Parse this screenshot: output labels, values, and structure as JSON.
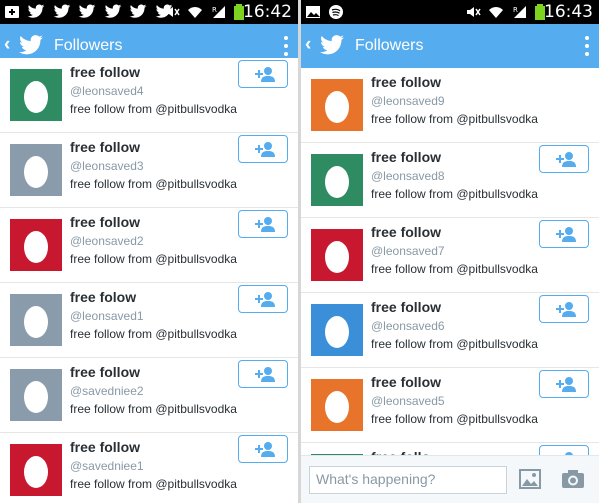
{
  "left": {
    "status_time": "16:42",
    "title": "Followers",
    "followers": [
      {
        "name": "free follow",
        "handle": "@leonsaved4",
        "desc": "free follow from @pitbullsvodka",
        "avatar_color": "#2e8b62"
      },
      {
        "name": "free follow",
        "handle": "@leonsaved3",
        "desc": "free follow from @pitbullsvodka",
        "avatar_color": "#8a9bab"
      },
      {
        "name": "free follow",
        "handle": "@leonsaved2",
        "desc": "free follow from @pitbullsvodka",
        "avatar_color": "#c8182f"
      },
      {
        "name": "free folow",
        "handle": "@leonsaved1",
        "desc": "free follow from @pitbullsvodka",
        "avatar_color": "#8a9bab"
      },
      {
        "name": "free follow",
        "handle": "@savedniee2",
        "desc": "free follow from @pitbullsvodka",
        "avatar_color": "#8a9bab"
      },
      {
        "name": "free follow",
        "handle": "@savedniee1",
        "desc": "free follow from @pitbullsvodka",
        "avatar_color": "#c8182f"
      }
    ]
  },
  "right": {
    "status_time": "16:43",
    "title": "Followers",
    "followers": [
      {
        "name": "free follow",
        "handle": "@leonsaved9",
        "desc": "free follow from @pitbullsvodka",
        "avatar_color": "#e8732a",
        "following": true
      },
      {
        "name": "free follow",
        "handle": "@leonsaved8",
        "desc": "free follow from @pitbullsvodka",
        "avatar_color": "#2e8b62"
      },
      {
        "name": "free follow",
        "handle": "@leonsaved7",
        "desc": "free follow from @pitbullsvodka",
        "avatar_color": "#c8182f"
      },
      {
        "name": "free follow",
        "handle": "@leonsaved6",
        "desc": "free follow from @pitbullsvodka",
        "avatar_color": "#3a8fd8"
      },
      {
        "name": "free follow",
        "handle": "@leonsaved5",
        "desc": "free follow from @pitbullsvodka",
        "avatar_color": "#e8732a"
      },
      {
        "name": "free follo",
        "handle": "",
        "desc": "",
        "avatar_color": "#2e8b62"
      }
    ],
    "composer": {
      "placeholder": "What's happening?",
      "photo_icon": "photo-icon",
      "camera_icon": "camera-icon"
    }
  },
  "colors": {
    "app_bar": "#55acee",
    "status_bar": "#000000",
    "text_primary": "#292f33",
    "text_secondary": "#8899a6",
    "button_border": "#55acee",
    "battery": "#7ed321"
  }
}
